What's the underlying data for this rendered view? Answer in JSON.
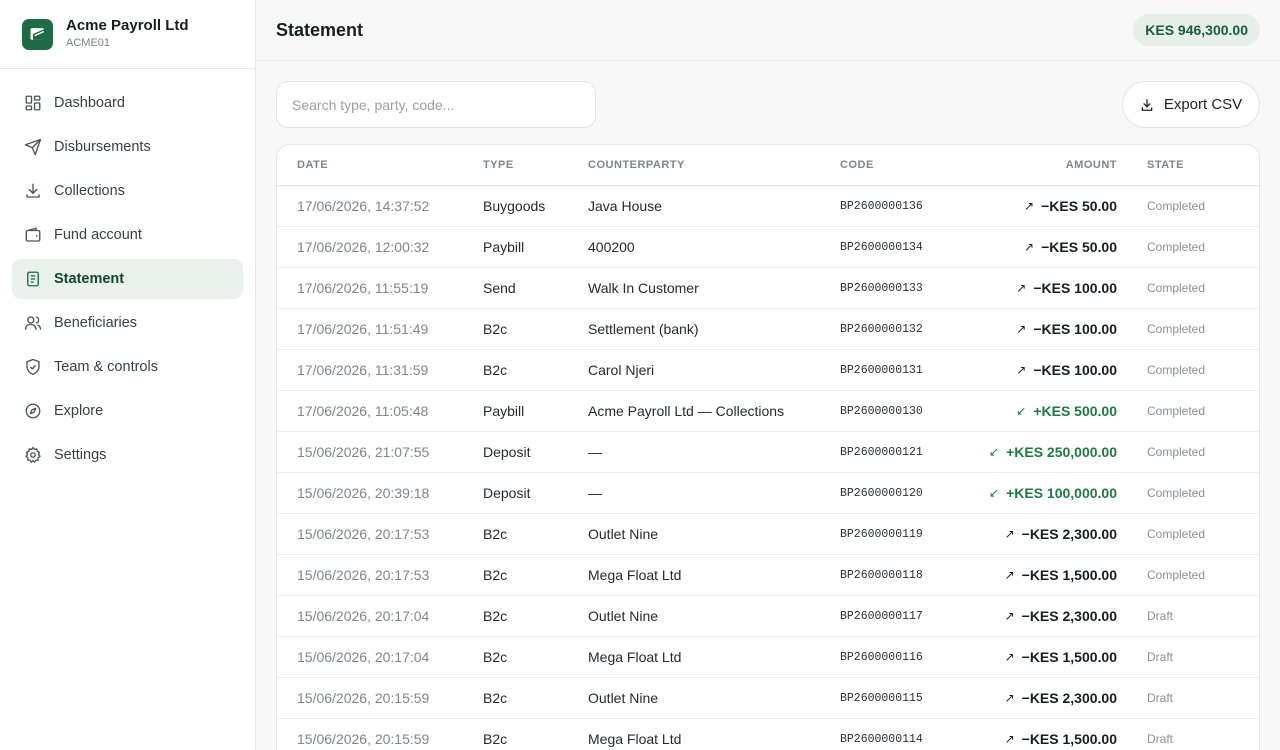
{
  "brand": {
    "name": "Acme Payroll Ltd",
    "code": "ACME01",
    "accent": "#1f6b45"
  },
  "nav": [
    {
      "label": "Dashboard",
      "icon": "grid-icon",
      "active": false
    },
    {
      "label": "Disbursements",
      "icon": "send-icon",
      "active": false
    },
    {
      "label": "Collections",
      "icon": "download-icon",
      "active": false
    },
    {
      "label": "Fund account",
      "icon": "wallet-icon",
      "active": false
    },
    {
      "label": "Statement",
      "icon": "document-icon",
      "active": true
    },
    {
      "label": "Beneficiaries",
      "icon": "users-icon",
      "active": false
    },
    {
      "label": "Team & controls",
      "icon": "shield-icon",
      "active": false
    },
    {
      "label": "Explore",
      "icon": "compass-icon",
      "active": false
    },
    {
      "label": "Settings",
      "icon": "gear-icon",
      "active": false
    }
  ],
  "header": {
    "title": "Statement",
    "balance": "KES 946,300.00"
  },
  "toolbar": {
    "search_placeholder": "Search type, party, code...",
    "export_label": "Export CSV"
  },
  "table": {
    "columns": {
      "date": "Date",
      "type": "Type",
      "counterparty": "Counterparty",
      "code": "Code",
      "amount": "Amount",
      "state": "State"
    },
    "rows": [
      {
        "date": "17/06/2026, 14:37:52",
        "type": "Buygoods",
        "counterparty": "Java House",
        "code": "BP2600000136",
        "amount": "−KES 50.00",
        "direction": "out",
        "state": "Completed"
      },
      {
        "date": "17/06/2026, 12:00:32",
        "type": "Paybill",
        "counterparty": "400200",
        "code": "BP2600000134",
        "amount": "−KES 50.00",
        "direction": "out",
        "state": "Completed"
      },
      {
        "date": "17/06/2026, 11:55:19",
        "type": "Send",
        "counterparty": "Walk In Customer",
        "code": "BP2600000133",
        "amount": "−KES 100.00",
        "direction": "out",
        "state": "Completed"
      },
      {
        "date": "17/06/2026, 11:51:49",
        "type": "B2c",
        "counterparty": "Settlement (bank)",
        "code": "BP2600000132",
        "amount": "−KES 100.00",
        "direction": "out",
        "state": "Completed"
      },
      {
        "date": "17/06/2026, 11:31:59",
        "type": "B2c",
        "counterparty": "Carol Njeri",
        "code": "BP2600000131",
        "amount": "−KES 100.00",
        "direction": "out",
        "state": "Completed"
      },
      {
        "date": "17/06/2026, 11:05:48",
        "type": "Paybill",
        "counterparty": "Acme Payroll Ltd — Collections",
        "code": "BP2600000130",
        "amount": "+KES 500.00",
        "direction": "in",
        "state": "Completed"
      },
      {
        "date": "15/06/2026, 21:07:55",
        "type": "Deposit",
        "counterparty": "—",
        "code": "BP2600000121",
        "amount": "+KES 250,000.00",
        "direction": "in",
        "state": "Completed"
      },
      {
        "date": "15/06/2026, 20:39:18",
        "type": "Deposit",
        "counterparty": "—",
        "code": "BP2600000120",
        "amount": "+KES 100,000.00",
        "direction": "in",
        "state": "Completed"
      },
      {
        "date": "15/06/2026, 20:17:53",
        "type": "B2c",
        "counterparty": "Outlet Nine",
        "code": "BP2600000119",
        "amount": "−KES 2,300.00",
        "direction": "out",
        "state": "Completed"
      },
      {
        "date": "15/06/2026, 20:17:53",
        "type": "B2c",
        "counterparty": "Mega Float Ltd",
        "code": "BP2600000118",
        "amount": "−KES 1,500.00",
        "direction": "out",
        "state": "Completed"
      },
      {
        "date": "15/06/2026, 20:17:04",
        "type": "B2c",
        "counterparty": "Outlet Nine",
        "code": "BP2600000117",
        "amount": "−KES 2,300.00",
        "direction": "out",
        "state": "Draft"
      },
      {
        "date": "15/06/2026, 20:17:04",
        "type": "B2c",
        "counterparty": "Mega Float Ltd",
        "code": "BP2600000116",
        "amount": "−KES 1,500.00",
        "direction": "out",
        "state": "Draft"
      },
      {
        "date": "15/06/2026, 20:15:59",
        "type": "B2c",
        "counterparty": "Outlet Nine",
        "code": "BP2600000115",
        "amount": "−KES 2,300.00",
        "direction": "out",
        "state": "Draft"
      },
      {
        "date": "15/06/2026, 20:15:59",
        "type": "B2c",
        "counterparty": "Mega Float Ltd",
        "code": "BP2600000114",
        "amount": "−KES 1,500.00",
        "direction": "out",
        "state": "Draft"
      }
    ]
  },
  "colors": {
    "incoming": "#1e7a45",
    "outgoing": "#17201b",
    "active_nav_bg": "#e8f1eb"
  }
}
